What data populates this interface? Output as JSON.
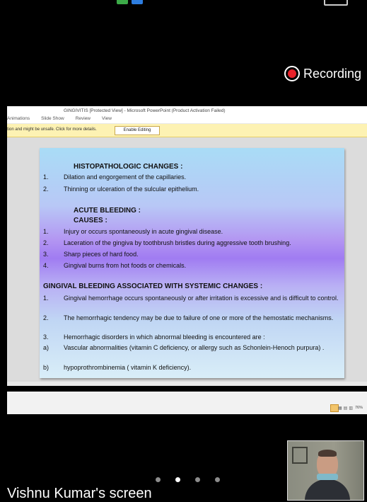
{
  "recording": {
    "label": "Recording"
  },
  "powerpoint": {
    "window_title": "GINGIVITIS [Protected View] - Microsoft PowerPoint (Product Activation Failed)",
    "menu": [
      "Animations",
      "Slide Show",
      "Review",
      "View"
    ],
    "warning_text": "tion and might be unsafe. Click for more details.",
    "enable_button": "Enable Editing",
    "zoom": "76%"
  },
  "slide": {
    "section1_heading": "HISTOPATHOLOGIC CHANGES :",
    "section1_items": [
      {
        "num": "1.",
        "text": "Dilation and engorgement of the capillaries."
      },
      {
        "num": "2.",
        "text": "Thinning or ulceration of the sulcular epithelium."
      }
    ],
    "section2_heading": "ACUTE BLEEDING :",
    "section2_subheading": "CAUSES :",
    "section2_items": [
      {
        "num": "1.",
        "text": "Injury or occurs spontaneously in acute gingival disease."
      },
      {
        "num": "2.",
        "text": "Laceration of the gingiva by toothbrush bristles during aggressive tooth brushing."
      },
      {
        "num": "3.",
        "text": "Sharp pieces of hard food."
      },
      {
        "num": "4.",
        "text": "Gingival burns from hot foods or chemicals."
      }
    ],
    "section3_heading": "GINGIVAL BLEEDING ASSOCIATED WITH SYSTEMIC CHANGES :",
    "section3_items": [
      {
        "num": "1.",
        "text": "Gingival hemorrhage occurs spontaneously or after irritation is excessive and is difficult to control."
      },
      {
        "num": "2.",
        "text": "The hemorrhagic tendency may be due to failure of one or more of the hemostatic mechanisms."
      },
      {
        "num": "3.",
        "text": "Hemorrhagic disorders in which abnormal bleeding is encountered are :"
      },
      {
        "num": "a)",
        "text": "Vascular abnormalities (vitamin C deficiency, or allergy such as Schonlein-Henoch purpura) ."
      },
      {
        "num": "b)",
        "text": "hypoprothrombinemia ( vitamin K deficiency)."
      }
    ]
  },
  "meeting": {
    "screen_label": "Vishnu Kumar's screen",
    "pages_total": 4,
    "active_page": 2
  },
  "colors": {
    "record_red": "#e8222a",
    "warning_bar": "#fdf2b3"
  }
}
